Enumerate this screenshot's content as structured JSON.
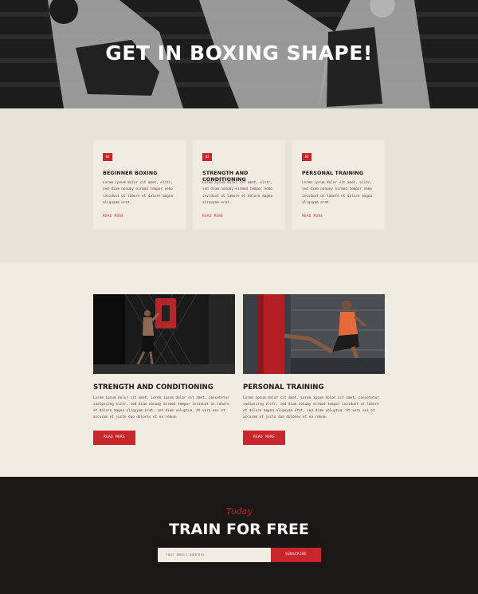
{
  "hero": {
    "title": "GET IN BOXING SHAPE!"
  },
  "programs": [
    {
      "number": "01",
      "title": "BEGINNER BOXING",
      "text": "Lorem ipsum dolor sit amet,  elitr, sed diam nonumy eirmod tempor nemo invidunt ut labore et dolore magna aliquyam erat.",
      "link": "READ MORE"
    },
    {
      "number": "02",
      "title": "STRENGTH AND CONDITIONING",
      "text": "Lorem ipsum dolor sit amet,  elitr, sed diam nonumy eirmod tempor nemo invidunt ut labore et dolore magna aliquyam erat.",
      "link": "READ MORE"
    },
    {
      "number": "03",
      "title": "PERSONAL TRAINING",
      "text": "Lorem ipsum dolor sit amet,  elitr, sed diam nonumy eirmod tempor nemo invidunt ut labore et dolore magna aliquyam erat.",
      "link": "READ MORE"
    }
  ],
  "features": [
    {
      "title": "STRENGTH AND CONDITIONING",
      "text": "Lorem ipsum dolor sit amet. Lorem ipsum dolor sit amet, consetetur sadipscing elitr, sed diam nonumy eirmod tempor invidunt ut labore et dolore magna aliquyam erat, sed diam voluptua. At vero eos et accusam et justo duo dolores et ea rebum.",
      "button": "READ MORE"
    },
    {
      "title": "PERSONAL TRAINING",
      "text": "Lorem ipsum dolor sit amet. Lorem ipsum dolor sit amet, consetetur sadipscing elitr, sed diam nonumy eirmod tempor invidunt ut labore et dolore magna aliquyam erat, sed diam voluptua. At vero eos et accusam et justo duo dolores et ea rebum.",
      "button": "READ MORE"
    }
  ],
  "cta": {
    "script": "Today",
    "title": "TRAIN FOR FREE",
    "email_placeholder": "Your email address",
    "button": "SUBSCRIBE"
  },
  "colors": {
    "accent": "#c8262b",
    "dark": "#1b1716",
    "cream": "#f1ece1",
    "beige": "#e8e3d8"
  }
}
